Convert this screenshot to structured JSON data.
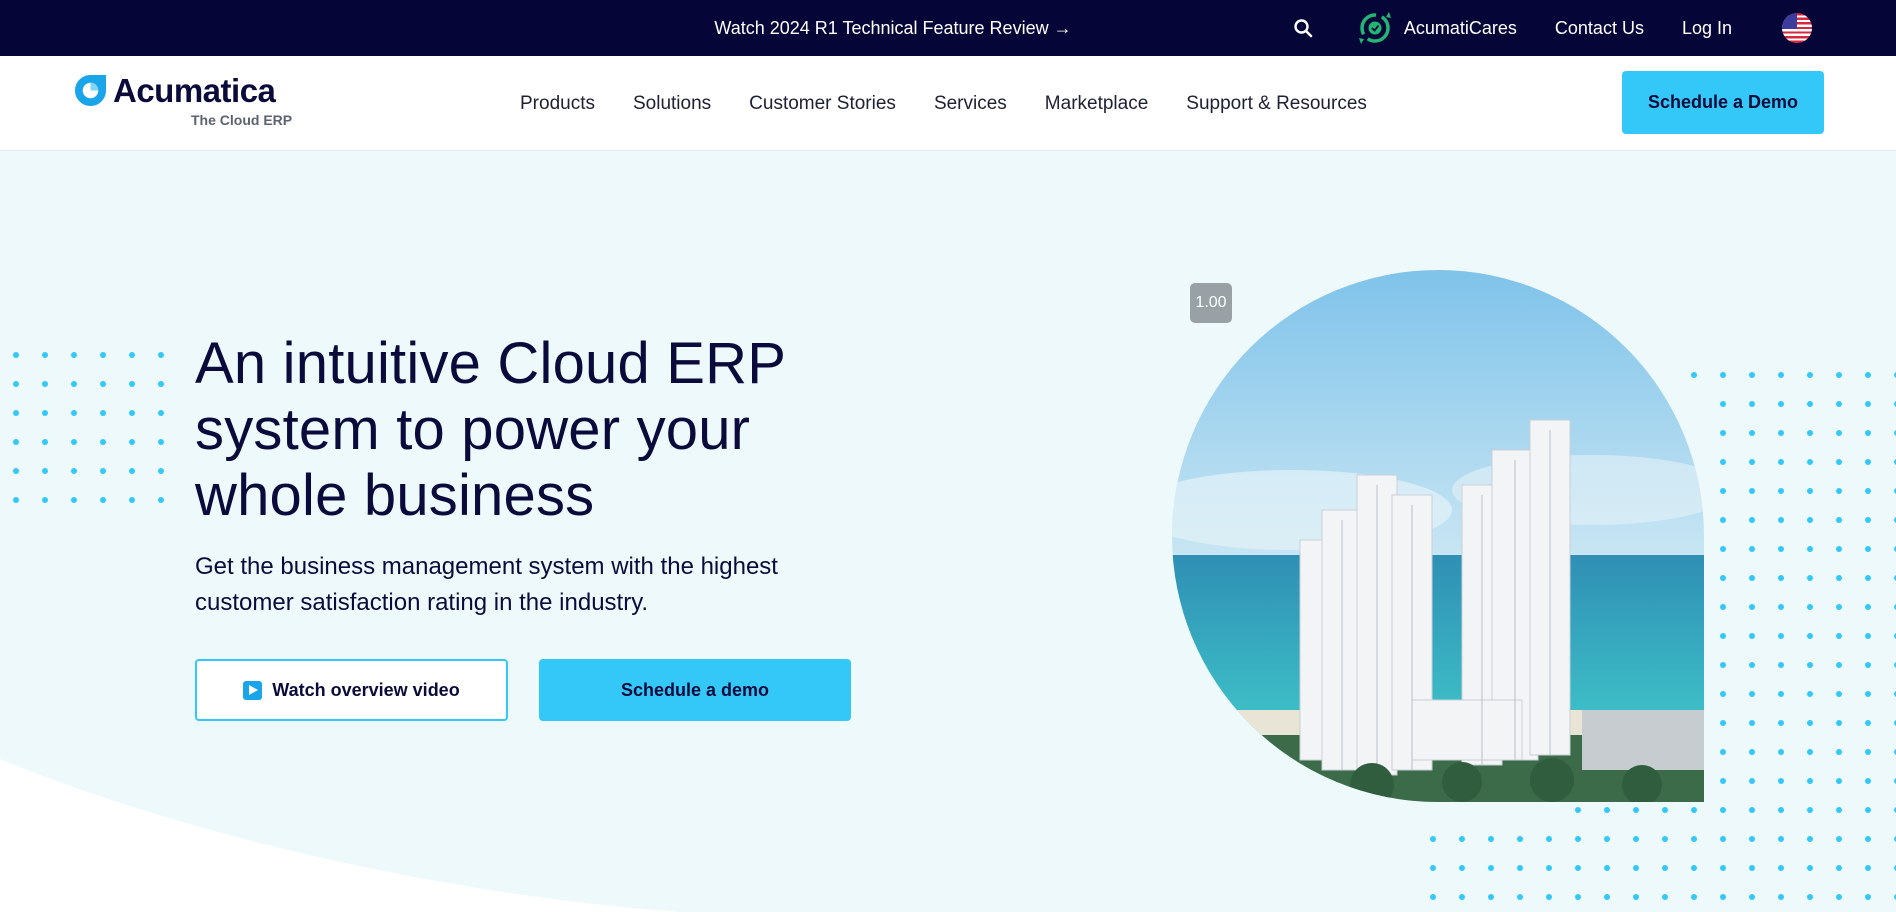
{
  "topbar": {
    "promo": "Watch 2024 R1 Technical Feature Review →",
    "search_icon": "search-icon",
    "cares_label": "AcumatiCares",
    "contact": "Contact Us",
    "login": "Log In",
    "flag_icon": "us-flag-icon",
    "background": "#050637"
  },
  "brand": {
    "name": "Acumatica",
    "tagline_pre": "The Cloud ",
    "tagline_bold": "ERP",
    "accent": "#34c8f8"
  },
  "nav": {
    "items": [
      "Products",
      "Solutions",
      "Customer Stories",
      "Services",
      "Marketplace",
      "Support & Resources"
    ],
    "cta": "Schedule a Demo"
  },
  "hero": {
    "headline": "An intuitive Cloud ERP system to power your whole business",
    "subhead": "Get the business management system with the highest customer satisfaction rating in the industry.",
    "video_button": "Watch overview video",
    "demo_button": "Schedule a demo",
    "speed": "1.00",
    "background": "#eef9fc"
  }
}
